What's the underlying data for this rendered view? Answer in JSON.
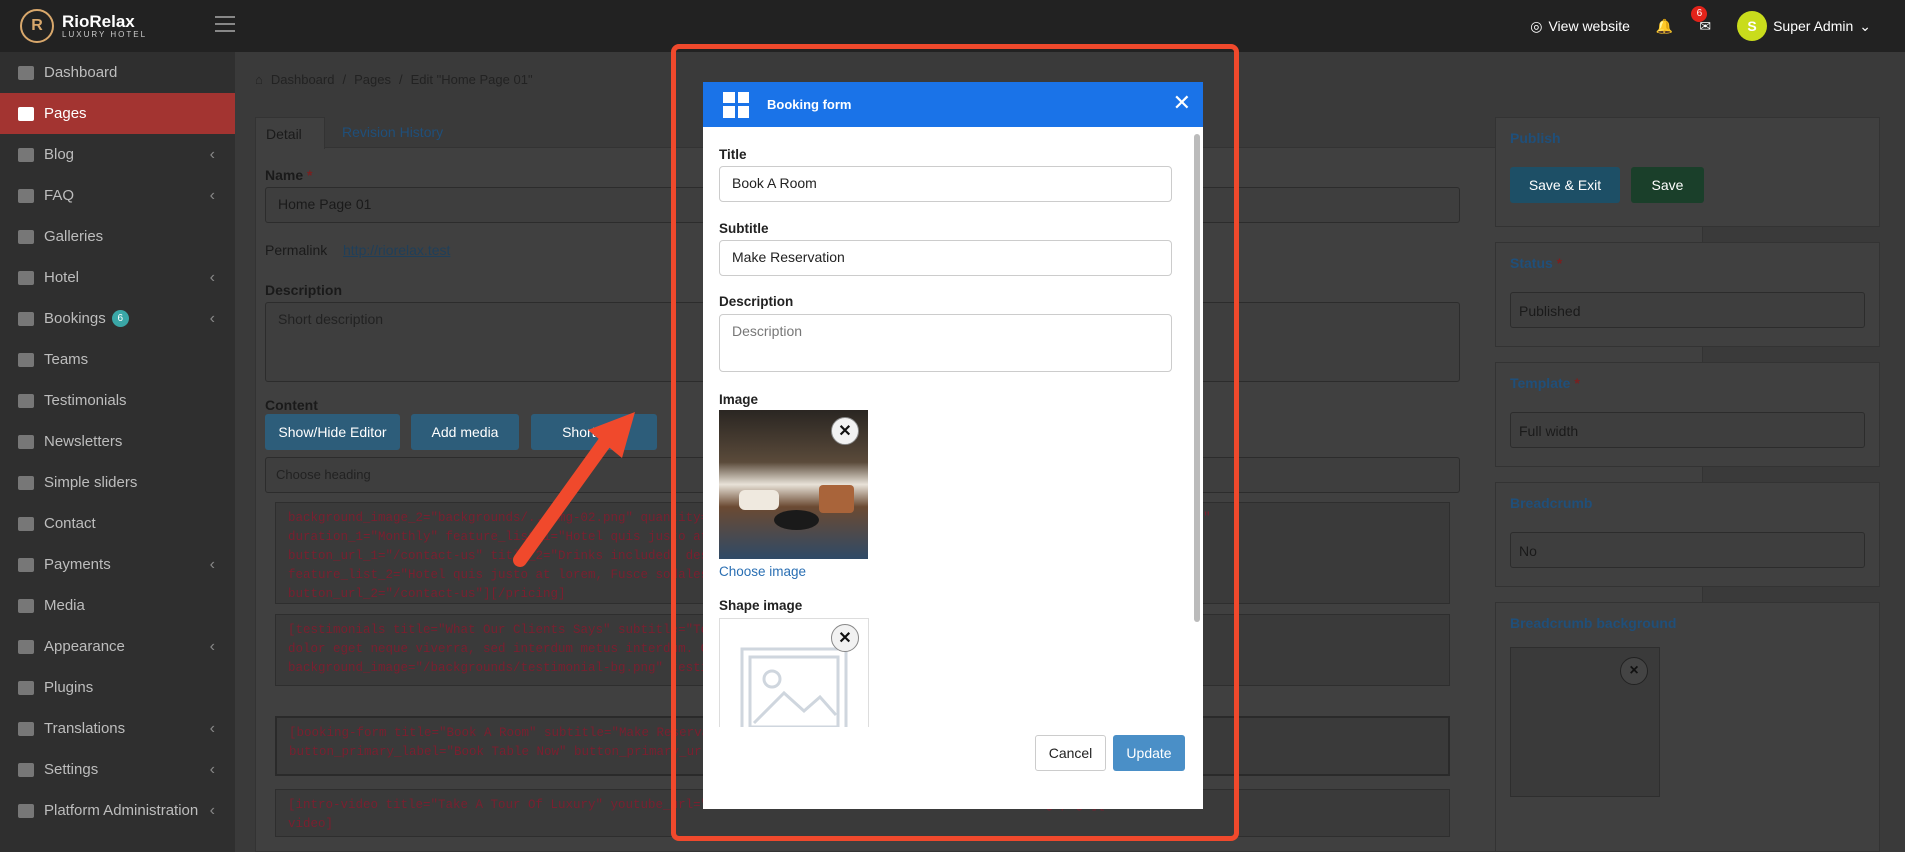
{
  "brand": {
    "name": "RioRelax",
    "tagline": "LUXURY HOTEL"
  },
  "topbar": {
    "view_website": "View website",
    "mail_count": "6",
    "user": "Super Admin",
    "user_initial": "S"
  },
  "sidebar": {
    "items": [
      {
        "label": "Dashboard"
      },
      {
        "label": "Pages"
      },
      {
        "label": "Blog"
      },
      {
        "label": "FAQ"
      },
      {
        "label": "Galleries"
      },
      {
        "label": "Hotel"
      },
      {
        "label": "Bookings",
        "badge": "6"
      },
      {
        "label": "Teams"
      },
      {
        "label": "Testimonials"
      },
      {
        "label": "Newsletters"
      },
      {
        "label": "Simple sliders"
      },
      {
        "label": "Contact"
      },
      {
        "label": "Payments"
      },
      {
        "label": "Media"
      },
      {
        "label": "Appearance"
      },
      {
        "label": "Plugins"
      },
      {
        "label": "Translations"
      },
      {
        "label": "Settings"
      },
      {
        "label": "Platform Administration"
      }
    ]
  },
  "breadcrumb": {
    "home": "Dashboard",
    "sep": "/",
    "pages": "Pages",
    "current": "Edit \"Home Page 01\""
  },
  "form": {
    "tab_detail": "Detail",
    "tab_revision": "Revision History",
    "name_label": "Name",
    "required": "*",
    "name_value": "Home Page 01",
    "permalink_label": "Permalink",
    "permalink_url": "http://riorelax.test",
    "description_label": "Description",
    "description_placeholder": "Short description",
    "content_label": "Content",
    "show_hide": "Show/Hide Editor",
    "add_media": "Add media",
    "shortcode": "Shortcode",
    "heading_select": "Choose heading"
  },
  "code_blocks": [
    "background_image_2=\"backgrounds/...img-02.png\" quantity=\"...\"                                 features=\"...price_1=\"$59.99\"\nduration_1=\"Monthly\" feature_list_1=\"Hotel quis justo at                                   button_label_1=\"Get Started\"\nbutton_url_1=\"/contact-us\" title_2=\"Drinks included\" desc...                              ion_2=\"Monthly\"\nfeature_list_2=\"Hotel quis justo at lorem, Fusce sodales                                   tarted \"\nbutton_url_2=\"/contact-us\"][/pricing]",
    "[testimonials title=\"What Our Clients Says\" subtitle=\"Tes...                              Pellentesque sollicitudin\ndolor eget neque viverra, sed interdum metus interdum. Cr...\nbackground_image=\"/backgrounds/testimonial-bg.png\" testi...",
    "[booking-form title=\"Book A Room\" subtitle=\"Make Reservat...                              an-img-01.png\"\nbutton_primary_label=\"Book Table Now\" button_primary_url=...",
    "[intro-video title=\"Take A Tour Of Luxury\" youtube_url=\"h...                               al/video-bg.png\"][/intro-\nvideo]"
  ],
  "right": {
    "publish": "Publish",
    "save_exit": "Save & Exit",
    "save": "Save",
    "status_label": "Status",
    "status_value": "Published",
    "template_label": "Template",
    "template_value": "Full width",
    "breadcrumb_label": "Breadcrumb",
    "breadcrumb_value": "No",
    "breadcrumb_bg_label": "Breadcrumb background"
  },
  "modal": {
    "title": "Booking form",
    "title_label": "Title",
    "title_value": "Book A Room",
    "subtitle_label": "Subtitle",
    "subtitle_value": "Make Reservation",
    "description_label": "Description",
    "description_placeholder": "Description",
    "image_label": "Image",
    "choose_image": "Choose image",
    "shape_image_label": "Shape image",
    "cancel": "Cancel",
    "update": "Update"
  },
  "colors": {
    "primary": "#1a73e8",
    "highlight": "#f0492c",
    "active_menu": "#a33431",
    "save": "#2e7d4f",
    "save_exit": "#3a8fb5",
    "update": "#4a8fc7"
  }
}
